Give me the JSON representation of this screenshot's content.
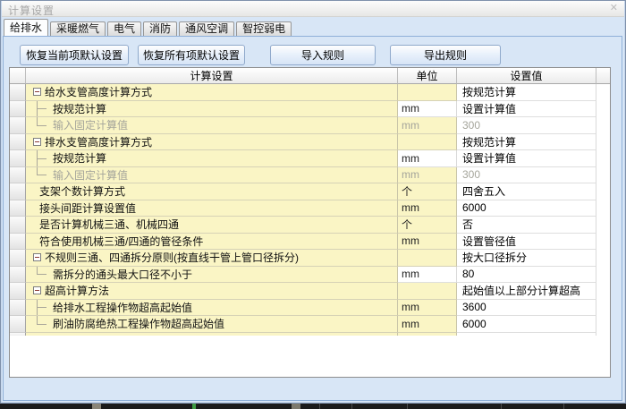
{
  "window": {
    "title": "计算设置"
  },
  "icons": {
    "close": "✕"
  },
  "colors": {
    "client_bg": "#d8e6f6",
    "row_yellow": "#faf5c5",
    "disabled_text": "#a5a59b",
    "expander_minus": "#8c3b36",
    "button_border": "#8fa9cb"
  },
  "tabs": [
    {
      "label": "给排水",
      "active": true
    },
    {
      "label": "采暖燃气",
      "active": false
    },
    {
      "label": "电气",
      "active": false
    },
    {
      "label": "消防",
      "active": false
    },
    {
      "label": "通风空调",
      "active": false
    },
    {
      "label": "智控弱电",
      "active": false
    }
  ],
  "toolbar": {
    "buttons": [
      {
        "name": "restore-current-defaults-button",
        "label": "恢复当前项默认设置"
      },
      {
        "name": "restore-all-defaults-button",
        "label": "恢复所有项默认设置"
      },
      {
        "name": "import-rules-button",
        "label": "导入规则"
      },
      {
        "name": "export-rules-button",
        "label": "导出规则"
      }
    ]
  },
  "table": {
    "headers": {
      "name": "计算设置",
      "unit": "单位",
      "value": "设置值"
    },
    "rows": [
      {
        "name": "给水支管高度计算方式",
        "unit": "",
        "value": "按规范计算",
        "kind": "parent"
      },
      {
        "name": "按规范计算",
        "unit": "mm",
        "value": "设置计算值",
        "kind": "child-mid",
        "unit_white": true
      },
      {
        "name": "输入固定计算值",
        "unit": "mm",
        "value": "300",
        "kind": "child-end",
        "disabled": true
      },
      {
        "name": "排水支管高度计算方式",
        "unit": "",
        "value": "按规范计算",
        "kind": "parent"
      },
      {
        "name": "按规范计算",
        "unit": "mm",
        "value": "设置计算值",
        "kind": "child-mid",
        "unit_white": true
      },
      {
        "name": "输入固定计算值",
        "unit": "mm",
        "value": "300",
        "kind": "child-end",
        "disabled": true
      },
      {
        "name": "支架个数计算方式",
        "unit": "个",
        "value": "四舍五入",
        "kind": "plain"
      },
      {
        "name": "接头间距计算设置值",
        "unit": "mm",
        "value": "6000",
        "kind": "plain"
      },
      {
        "name": "是否计算机械三通、机械四通",
        "unit": "个",
        "value": "否",
        "kind": "plain"
      },
      {
        "name": "符合使用机械三通/四通的管径条件",
        "unit": "mm",
        "value": "设置管径值",
        "kind": "plain"
      },
      {
        "name": "不规则三通、四通拆分原则(按直线干管上管口径拆分)",
        "unit": "",
        "value": "按大口径拆分",
        "kind": "parent"
      },
      {
        "name": "需拆分的通头最大口径不小于",
        "unit": "mm",
        "value": "80",
        "kind": "child-end",
        "unit_white": true
      },
      {
        "name": "超高计算方法",
        "unit": "",
        "value": "起始值以上部分计算超高",
        "kind": "parent"
      },
      {
        "name": "给排水工程操作物超高起始值",
        "unit": "mm",
        "value": "3600",
        "kind": "child-mid"
      },
      {
        "name": "刷油防腐绝热工程操作物超高起始值",
        "unit": "mm",
        "value": "6000",
        "kind": "child-end"
      }
    ]
  }
}
